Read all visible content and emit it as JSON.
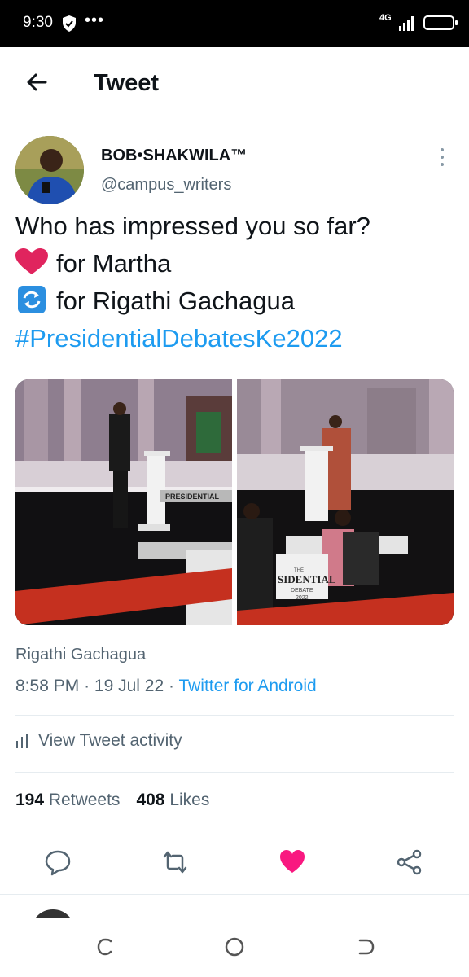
{
  "status_bar": {
    "time": "9:30",
    "dots": "•••",
    "network": "4G"
  },
  "header": {
    "title": "Tweet"
  },
  "tweet": {
    "author_name": "BOB•SHAKWILA™",
    "author_handle": "@campus_writers",
    "text_line1": "Who has impressed you so far?",
    "text_line2": "for Martha",
    "text_line3": "for Rigathi Gachagua",
    "hashtag": "#PresidentialDebatesKe2022",
    "caption": "Rigathi Gachagua",
    "time": "8:58 PM",
    "date": "19 Jul 22",
    "separator": "·",
    "source": "Twitter for Android",
    "activity_label": "View Tweet activity",
    "retweet_count": "194",
    "retweet_label": "Retweets",
    "like_count": "408",
    "like_label": "Likes",
    "podium_text_1": "PRESIDENTIAL",
    "podium_text_2": "THE",
    "podium_text_3": "SIDENTIAL",
    "podium_text_4": "DEBATE",
    "podium_text_5": "2022"
  },
  "icons": {
    "back": "arrow-left-icon",
    "more": "more-vertical-icon",
    "reply": "reply-icon",
    "retweet": "retweet-icon",
    "like": "heart-icon",
    "share": "share-icon"
  },
  "colors": {
    "accent": "#1d9bf0",
    "like": "#f91880",
    "text": "#0f1419",
    "secondary": "#536471"
  }
}
